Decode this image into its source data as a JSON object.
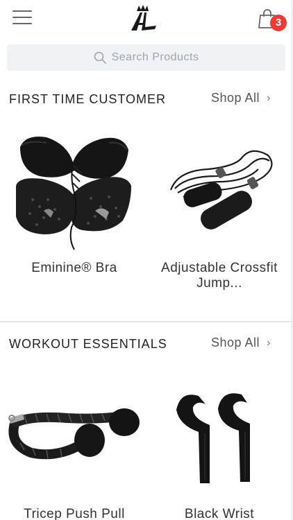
{
  "header": {
    "menu_icon": "hamburger-menu-icon",
    "logo_icon": "crown-logo-icon",
    "cart_icon": "shopping-bag-icon",
    "cart_count": "3",
    "badge_color": "#ef3b36"
  },
  "search": {
    "placeholder": "Search Products",
    "icon": "search-icon"
  },
  "sections": [
    {
      "title": "FIRST TIME CUSTOMER",
      "shop_all": "Shop All",
      "products": [
        {
          "name": "Eminine® Bra",
          "image": "bra-product-image"
        },
        {
          "name": "Adjustable Crossfit Jump...",
          "image": "jump-rope-product-image"
        }
      ]
    },
    {
      "title": "WORKOUT ESSENTIALS",
      "shop_all": "Shop All",
      "products": [
        {
          "name": "Tricep Push Pull",
          "image": "tricep-rope-product-image"
        },
        {
          "name": "Black Wrist",
          "image": "wrist-straps-product-image"
        }
      ]
    }
  ]
}
